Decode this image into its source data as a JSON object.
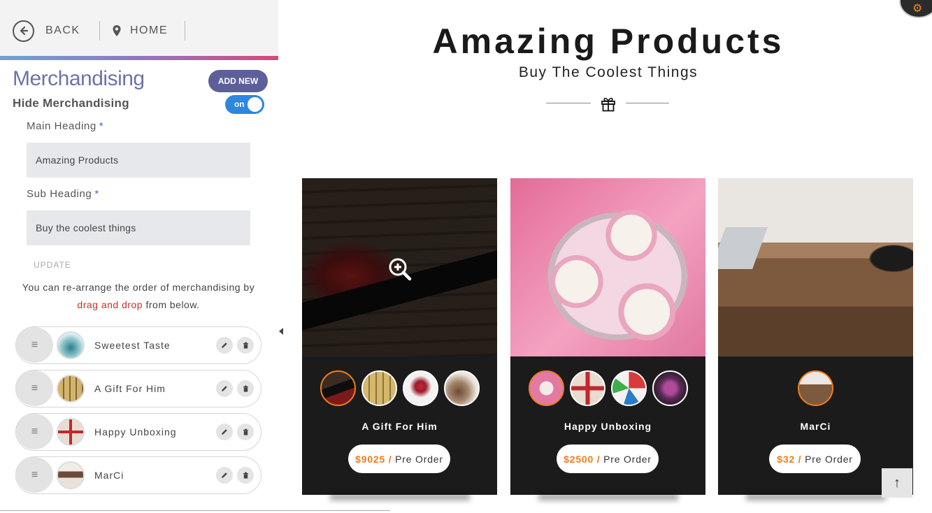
{
  "nav": {
    "back_label": "BACK",
    "home_label": "HOME"
  },
  "panel": {
    "title": "Merchandising",
    "add_new": "ADD NEW",
    "hide_label": "Hide Merchandising",
    "toggle_text": "on",
    "main_heading_label": "Main Heading",
    "main_heading_value": "Amazing Products",
    "sub_heading_label": "Sub Heading",
    "sub_heading_value": "Buy the coolest things",
    "required_mark": "*",
    "update": "UPDATE",
    "instr_1": "You can re-arrange the order of merchandising by",
    "instr_red": "drag and drop",
    "instr_2": "from below.",
    "items": [
      {
        "label": "Sweetest Taste"
      },
      {
        "label": "A Gift For Him"
      },
      {
        "label": "Happy Unboxing"
      },
      {
        "label": "MarCi"
      }
    ]
  },
  "main": {
    "title": "Amazing Products",
    "subtitle": "Buy The Coolest Things",
    "cards": [
      {
        "name": "A Gift For Him",
        "price": "$9025 /",
        "action": "Pre Order"
      },
      {
        "name": "Happy Unboxing",
        "price": "$2500 /",
        "action": "Pre Order"
      },
      {
        "name": "MarCi",
        "price": "$32 /",
        "action": "Pre Order"
      }
    ]
  },
  "colors": {
    "accent": "#f07d1a",
    "panel_title": "#6b74a8",
    "add_button": "#5d5f9a",
    "toggle": "#2e86de",
    "card_bg": "#1b1b1b"
  }
}
